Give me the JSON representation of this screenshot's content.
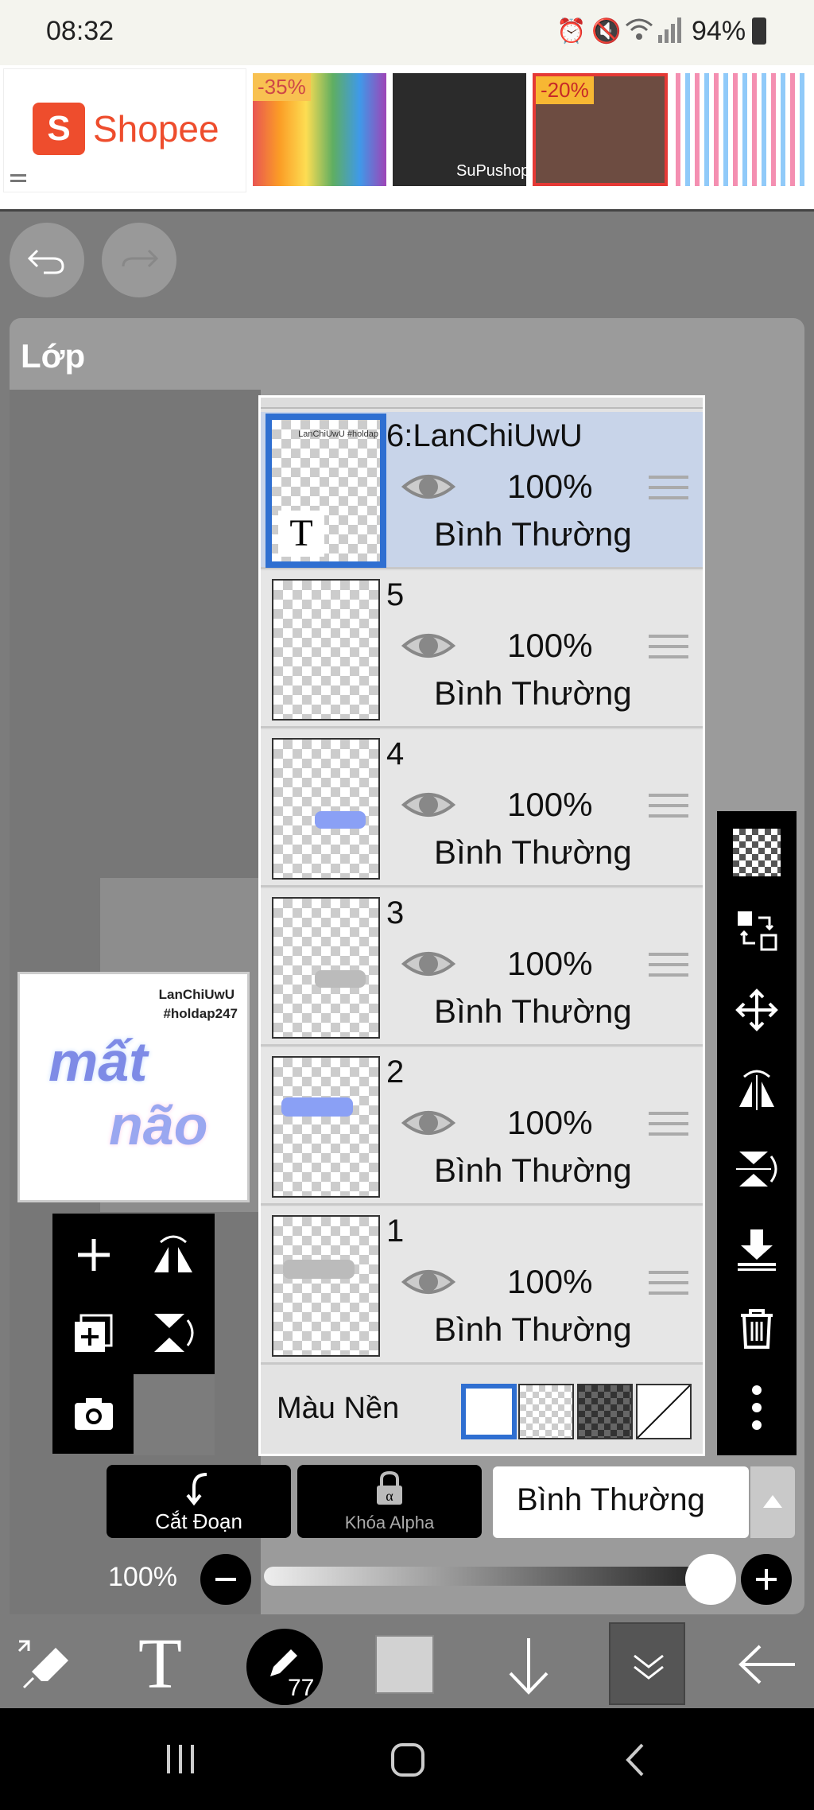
{
  "status": {
    "time": "08:32",
    "battery": "94%"
  },
  "ad": {
    "brand": "Shopee",
    "items": [
      {
        "badge": "-35%"
      },
      {
        "caption": "SuPushop"
      },
      {
        "badge": "-20%"
      },
      {}
    ]
  },
  "panel": {
    "title": "Lớp"
  },
  "layers": [
    {
      "name": "6:LanChiUwU",
      "opacity": "100%",
      "blend": "Bình Thường",
      "selected": true,
      "thumb_text": "LanChiUwU #holdap",
      "type_glyph": "T"
    },
    {
      "name": "5",
      "opacity": "100%",
      "blend": "Bình Thường"
    },
    {
      "name": "4",
      "opacity": "100%",
      "blend": "Bình Thường"
    },
    {
      "name": "3",
      "opacity": "100%",
      "blend": "Bình Thường"
    },
    {
      "name": "2",
      "opacity": "100%",
      "blend": "Bình Thường"
    },
    {
      "name": "1",
      "opacity": "100%",
      "blend": "Bình Thường"
    }
  ],
  "background": {
    "label": "Màu Nền"
  },
  "preview": {
    "line1": "LanChiUwU",
    "line2": "#holdap247",
    "art1": "mất",
    "art2": "não"
  },
  "actions": {
    "clip": "Cắt Đoạn",
    "alpha_lock": "Khóa Alpha",
    "blend_mode": "Bình Thường"
  },
  "opacity": {
    "label": "100%",
    "value": 1.0
  },
  "tools": {
    "brush_size": "77"
  },
  "colors": {
    "accent": "#2f6fd1",
    "selected_row": "#c8d4e9",
    "shopee": "#ee4d2d"
  }
}
